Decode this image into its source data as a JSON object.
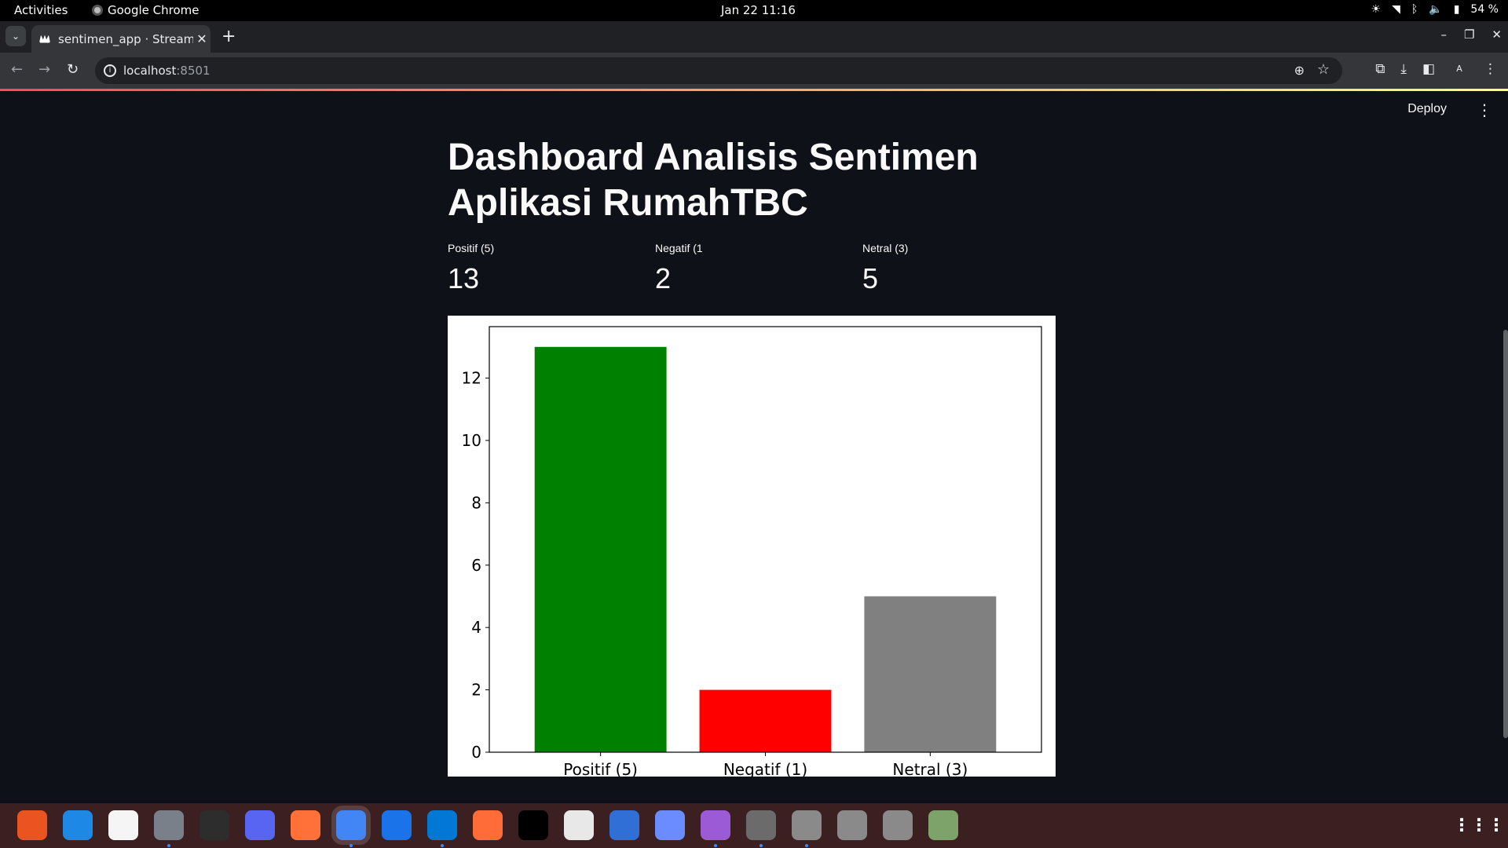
{
  "system": {
    "activities": "Activities",
    "app_name": "Google Chrome",
    "clock": "Jan 22  11:16",
    "battery": "54 %"
  },
  "browser": {
    "tab_title": "sentimen_app · Streamlit",
    "url_host": "localhost",
    "url_port": ":8501",
    "profile_initial": "A"
  },
  "app": {
    "deploy_label": "Deploy",
    "title": "Dashboard Analisis Sentimen Aplikasi RumahTBC",
    "metrics": [
      {
        "label": "Positif (5)",
        "value": "13"
      },
      {
        "label": "Negatif (1",
        "value": "2"
      },
      {
        "label": "Netral (3)",
        "value": "5"
      }
    ]
  },
  "chart_data": {
    "type": "bar",
    "categories": [
      "Positif (5)",
      "Negatif (1)",
      "Netral (3)"
    ],
    "values": [
      13,
      2,
      5
    ],
    "colors": [
      "#008000",
      "#ff0000",
      "#808080"
    ],
    "ylim": [
      0,
      13.65
    ],
    "yticks": [
      0,
      2,
      4,
      6,
      8,
      10,
      12
    ],
    "title": "",
    "xlabel": "",
    "ylabel": "",
    "grid": false
  },
  "dock": {
    "items": [
      "app-center-icon",
      "help-icon",
      "rhythmbox-icon",
      "files-icon",
      "terminal-icon",
      "discord-icon",
      "firefox-icon",
      "chrome-icon",
      "android-studio-icon",
      "vscode-icon",
      "postman-icon",
      "intellij-icon",
      "document-viewer-icon",
      "text-editor-icon",
      "tasks-icon",
      "video-icon",
      "settings-icon",
      "ssd-drive-icon",
      "ssd-drive-icon",
      "ssd-drive-icon",
      "trash-icon"
    ],
    "dock_colors": [
      "#e95420",
      "#1e88e5",
      "#f5f5f5",
      "#7a8089",
      "#2d2d2d",
      "#5865f2",
      "#ff7139",
      "#4285f4",
      "#1a73e8",
      "#0078d4",
      "#ff6c37",
      "#000000",
      "#e8e8e8",
      "#2f6fd6",
      "#6a8cff",
      "#9c5bd6",
      "#6b6b6b",
      "#8a8a8a",
      "#8a8a8a",
      "#8a8a8a",
      "#7da36a"
    ]
  }
}
